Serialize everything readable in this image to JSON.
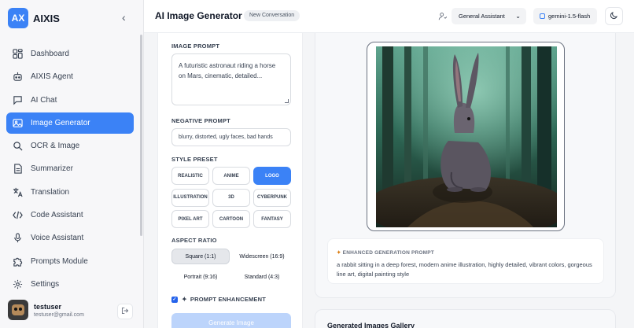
{
  "app": {
    "logo_text": "AX",
    "name": "AIXIS"
  },
  "sidebar": {
    "items": [
      {
        "label": "Dashboard",
        "icon": "dashboard-icon"
      },
      {
        "label": "AIXIS Agent",
        "icon": "robot-icon"
      },
      {
        "label": "AI Chat",
        "icon": "chat-icon"
      },
      {
        "label": "Image Generator",
        "icon": "image-icon",
        "active": true
      },
      {
        "label": "OCR & Image",
        "icon": "search-icon"
      },
      {
        "label": "Summarizer",
        "icon": "document-icon"
      },
      {
        "label": "Translation",
        "icon": "translate-icon"
      },
      {
        "label": "Code Assistant",
        "icon": "code-icon"
      },
      {
        "label": "Voice Assistant",
        "icon": "microphone-icon"
      },
      {
        "label": "Prompts Module",
        "icon": "puzzle-icon"
      },
      {
        "label": "Settings",
        "icon": "gear-icon"
      }
    ]
  },
  "user": {
    "name": "testuser",
    "email": "testuser@gmail.com"
  },
  "header": {
    "title": "AI Image Generator",
    "conversation_badge": "New Conversation",
    "agent_select": "General Assistant",
    "model": "gemini-1.5-flash"
  },
  "form": {
    "image_prompt_label": "IMAGE PROMPT",
    "image_prompt_value": "A futuristic astronaut riding a horse on Mars, cinematic, detailed...",
    "negative_prompt_label": "NEGATIVE PROMPT",
    "negative_prompt_value": "blurry, distorted, ugly faces, bad hands",
    "style_preset_label": "STYLE PRESET",
    "presets": [
      {
        "label": "REALISTIC"
      },
      {
        "label": "ANIME"
      },
      {
        "label": "LOGO",
        "active": true
      },
      {
        "label": "ILLUSTRATION"
      },
      {
        "label": "3D"
      },
      {
        "label": "CYBERPUNK"
      },
      {
        "label": "PIXEL ART"
      },
      {
        "label": "CARTOON"
      },
      {
        "label": "FANTASY"
      }
    ],
    "aspect_ratio_label": "ASPECT RATIO",
    "ratios": [
      {
        "label": "Square (1:1)",
        "active": true
      },
      {
        "label": "Widescreen (16:9)"
      },
      {
        "label": "Portrait (9:16)"
      },
      {
        "label": "Standard (4:3)"
      }
    ],
    "prompt_enhancement_label": "PROMPT ENHANCEMENT",
    "prompt_enhancement_checked": true,
    "generate_label": "Generate Image"
  },
  "result": {
    "enhanced_title": "ENHANCED GENERATION PROMPT",
    "enhanced_text": "a rabbit sitting in a deep forest, modern anime illustration, highly detailed, vibrant colors, gorgeous line art, digital painting style"
  },
  "gallery": {
    "title": "Generated Images Gallery"
  },
  "colors": {
    "accent": "#3b82f6",
    "accent_disabled": "#bcd4fb"
  }
}
